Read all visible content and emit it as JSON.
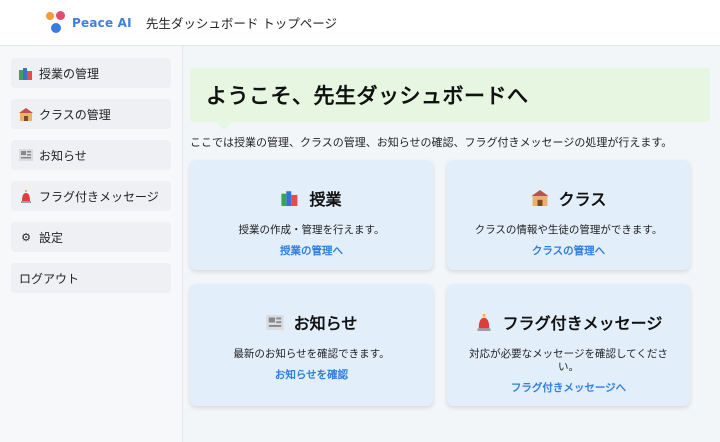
{
  "header": {
    "logo_text": "Peace AI",
    "title": "先生ダッシュボード トップページ"
  },
  "sidebar": {
    "items": [
      {
        "label": "授業の管理",
        "icon": "books-icon"
      },
      {
        "label": "クラスの管理",
        "icon": "school-icon"
      },
      {
        "label": "お知らせ",
        "icon": "newspaper-icon"
      },
      {
        "label": "フラグ付きメッセージ",
        "icon": "siren-icon"
      },
      {
        "label": "設定",
        "icon": "gear-icon"
      },
      {
        "label": "ログアウト",
        "icon": ""
      }
    ]
  },
  "main": {
    "welcome_title": "ようこそ、先生ダッシュボードへ",
    "intro": "ここでは授業の管理、クラスの管理、お知らせの確認、フラグ付きメッセージの処理が行えます。",
    "cards": [
      {
        "title": "授業",
        "icon": "books-icon",
        "description": "授業の作成・管理を行えます。",
        "link": "授業の管理へ"
      },
      {
        "title": "クラス",
        "icon": "school-icon",
        "description": "クラスの情報や生徒の管理ができます。",
        "link": "クラスの管理へ"
      },
      {
        "title": "お知らせ",
        "icon": "newspaper-icon",
        "description": "最新のお知らせを確認できます。",
        "link": "お知らせを確認"
      },
      {
        "title": "フラグ付きメッセージ",
        "icon": "siren-icon",
        "description": "対応が必要なメッセージを確認してください。",
        "link": "フラグ付きメッセージへ"
      }
    ]
  },
  "colors": {
    "accent": "#2f7fe0",
    "welcome_bg": "#e7f6e1",
    "card_bg": "#e3eefb"
  }
}
